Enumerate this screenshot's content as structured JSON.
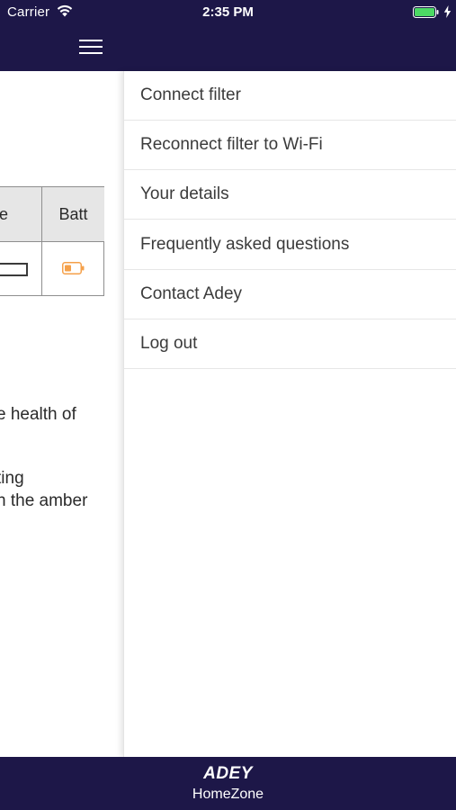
{
  "status_bar": {
    "carrier": "Carrier",
    "time": "2:35 PM",
    "battery_level": 1.0,
    "battery_color": "#4cd964"
  },
  "header": {
    "background": "#1d1748",
    "menu_icon": "hamburger-icon"
  },
  "background_content": {
    "table": {
      "headers": [
        "e",
        "Batt"
      ],
      "row": {
        "status_indicator": "empty-bar",
        "battery_icon": "battery-low-icon",
        "battery_color": "#f5a04a"
      }
    },
    "text_lines": [
      "e health of",
      "ting",
      "n the amber"
    ]
  },
  "menu": {
    "items": [
      {
        "label": "Connect filter"
      },
      {
        "label": "Reconnect filter to Wi-Fi"
      },
      {
        "label": "Your details"
      },
      {
        "label": "Frequently asked questions"
      },
      {
        "label": "Contact Adey"
      },
      {
        "label": "Log out"
      }
    ]
  },
  "footer": {
    "logo": "ADEY",
    "subtitle": "HomeZone"
  }
}
